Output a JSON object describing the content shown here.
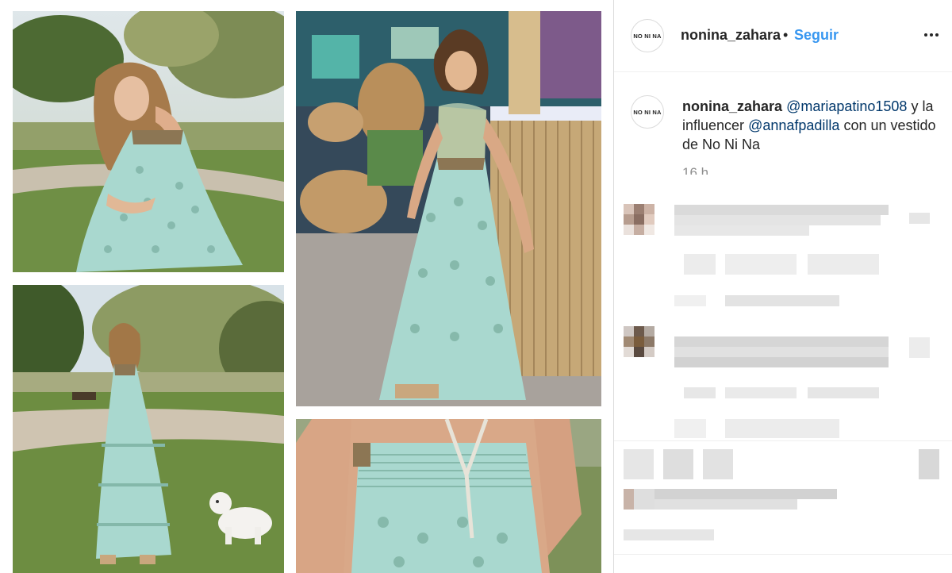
{
  "post": {
    "author": "nonina_zahara",
    "separator": "•",
    "follow_label": "Seguir",
    "avatar_text": "NO NI NA",
    "caption": {
      "author": "nonina_zahara",
      "mention1": "@mariapatino1508",
      "text_between": "y la influencer",
      "mention2": "@annafpadilla",
      "text_after": "con un vestido de No Ni Na"
    },
    "time": "16 h"
  },
  "colors": {
    "follow_blue": "#3897f0",
    "dress_mint": "#a9d8cf",
    "grass_green": "#6f8f45"
  },
  "icons": {
    "more": "more-horizontal-icon"
  }
}
